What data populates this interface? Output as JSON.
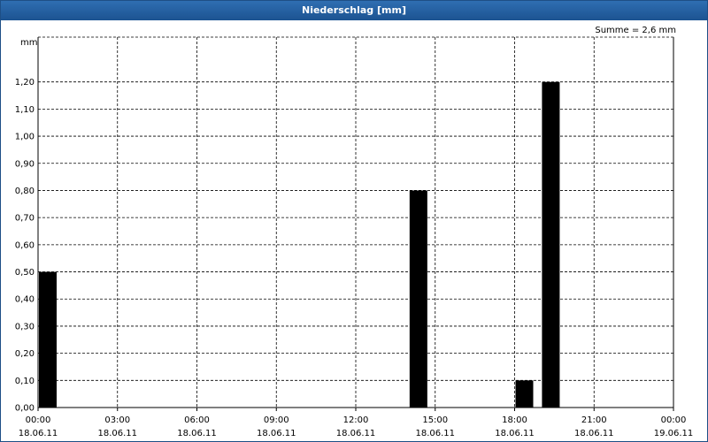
{
  "window": {
    "title": "Niederschlag [mm]"
  },
  "summary_text": "Summe = 2,6 mm",
  "chart_data": {
    "type": "bar",
    "title": "Niederschlag [mm]",
    "ylabel": "mm",
    "xlabel": "",
    "ylim": [
      0,
      1.3
    ],
    "yticks": [
      "0,00",
      "0,10",
      "0,20",
      "0,30",
      "0,40",
      "0,50",
      "0,60",
      "0,70",
      "0,80",
      "0,90",
      "1,00",
      "1,10",
      "1,20"
    ],
    "xticks": [
      {
        "time": "00:00",
        "date": "18.06.11"
      },
      {
        "time": "03:00",
        "date": "18.06.11"
      },
      {
        "time": "06:00",
        "date": "18.06.11"
      },
      {
        "time": "09:00",
        "date": "18.06.11"
      },
      {
        "time": "12:00",
        "date": "18.06.11"
      },
      {
        "time": "15:00",
        "date": "18.06.11"
      },
      {
        "time": "18:00",
        "date": "18.06.11"
      },
      {
        "time": "21:00",
        "date": "18.06.11"
      },
      {
        "time": "00:00",
        "date": "19.06.11"
      }
    ],
    "bars": [
      {
        "x": "18.06.11 00:00",
        "value": 0.5
      },
      {
        "x": "18.06.11 14:00",
        "value": 0.8
      },
      {
        "x": "18.06.11 18:00",
        "value": 0.1
      },
      {
        "x": "18.06.11 19:00",
        "value": 1.2
      }
    ],
    "bar_color": "#000000",
    "grid": true,
    "grid_style": "dashed"
  }
}
